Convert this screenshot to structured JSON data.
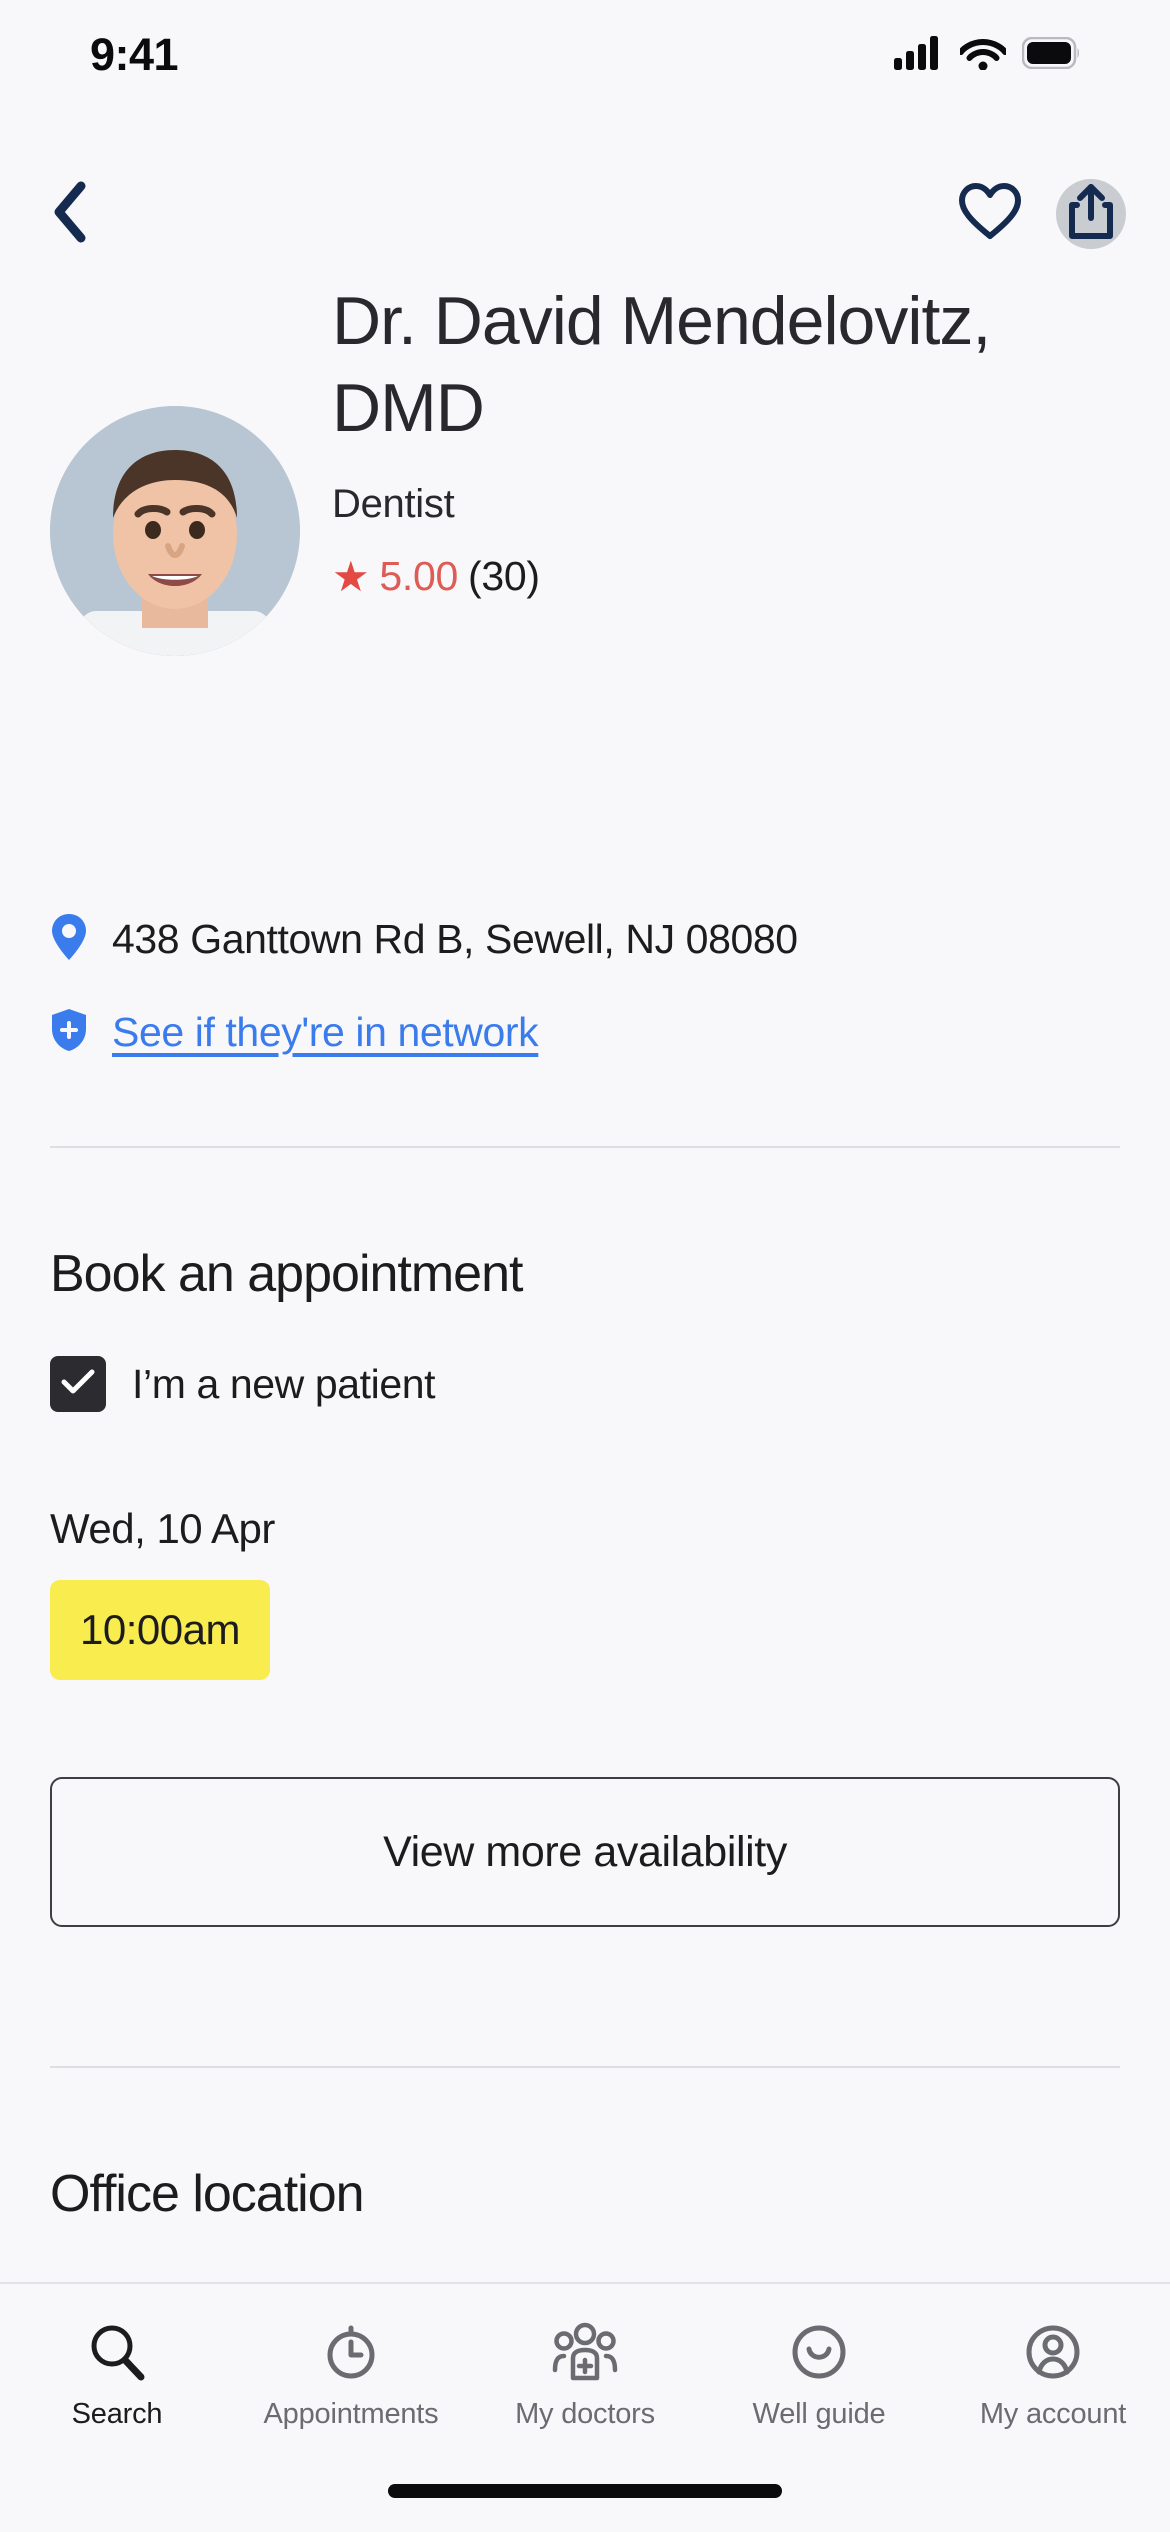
{
  "status_bar": {
    "time": "9:41",
    "icons": [
      "cellular-signal-icon",
      "wifi-icon",
      "battery-icon"
    ]
  },
  "nav_bar": {
    "back_icon": "chevron-left-icon",
    "favorite_icon": "heart-icon",
    "share_icon": "share-icon"
  },
  "doctor": {
    "name": "Dr. David Mendelovitz, DMD",
    "avatar_icon": "doctor-avatar",
    "specialty": "Dentist",
    "rating_star_icon": "star-icon",
    "rating_value": "5.00",
    "rating_count": "(30)",
    "address": "438 Ganttown Rd B, Sewell, NJ 08080",
    "address_icon": "map-pin-icon",
    "network_link": "See if they're in network",
    "network_icon": "shield-plus-icon"
  },
  "booking": {
    "section_title": "Book an appointment",
    "new_patient_label": "I’m a new patient",
    "new_patient_checked": true,
    "checkbox_icon": "checkmark-icon",
    "date_label": "Wed, 10 Apr",
    "time_slots": [
      "10:00am"
    ],
    "view_more_label": "View more availability"
  },
  "office": {
    "section_title": "Office location"
  },
  "tab_bar": {
    "items": [
      {
        "label": "Search",
        "icon": "search-icon",
        "active": true
      },
      {
        "label": "Appointments",
        "icon": "clock-icon",
        "active": false
      },
      {
        "label": "My doctors",
        "icon": "people-plus-icon",
        "active": false
      },
      {
        "label": "Well guide",
        "icon": "smiley-icon",
        "active": false
      },
      {
        "label": "My account",
        "icon": "person-circle-icon",
        "active": false
      }
    ]
  },
  "colors": {
    "background": "#f8f8fa",
    "navy": "#142a4e",
    "link_blue": "#3a7cec",
    "rating_red": "#de5c56",
    "slot_yellow": "#f9ec4f",
    "text_dark": "#1c1c1f",
    "text_muted": "#6b6b72"
  }
}
